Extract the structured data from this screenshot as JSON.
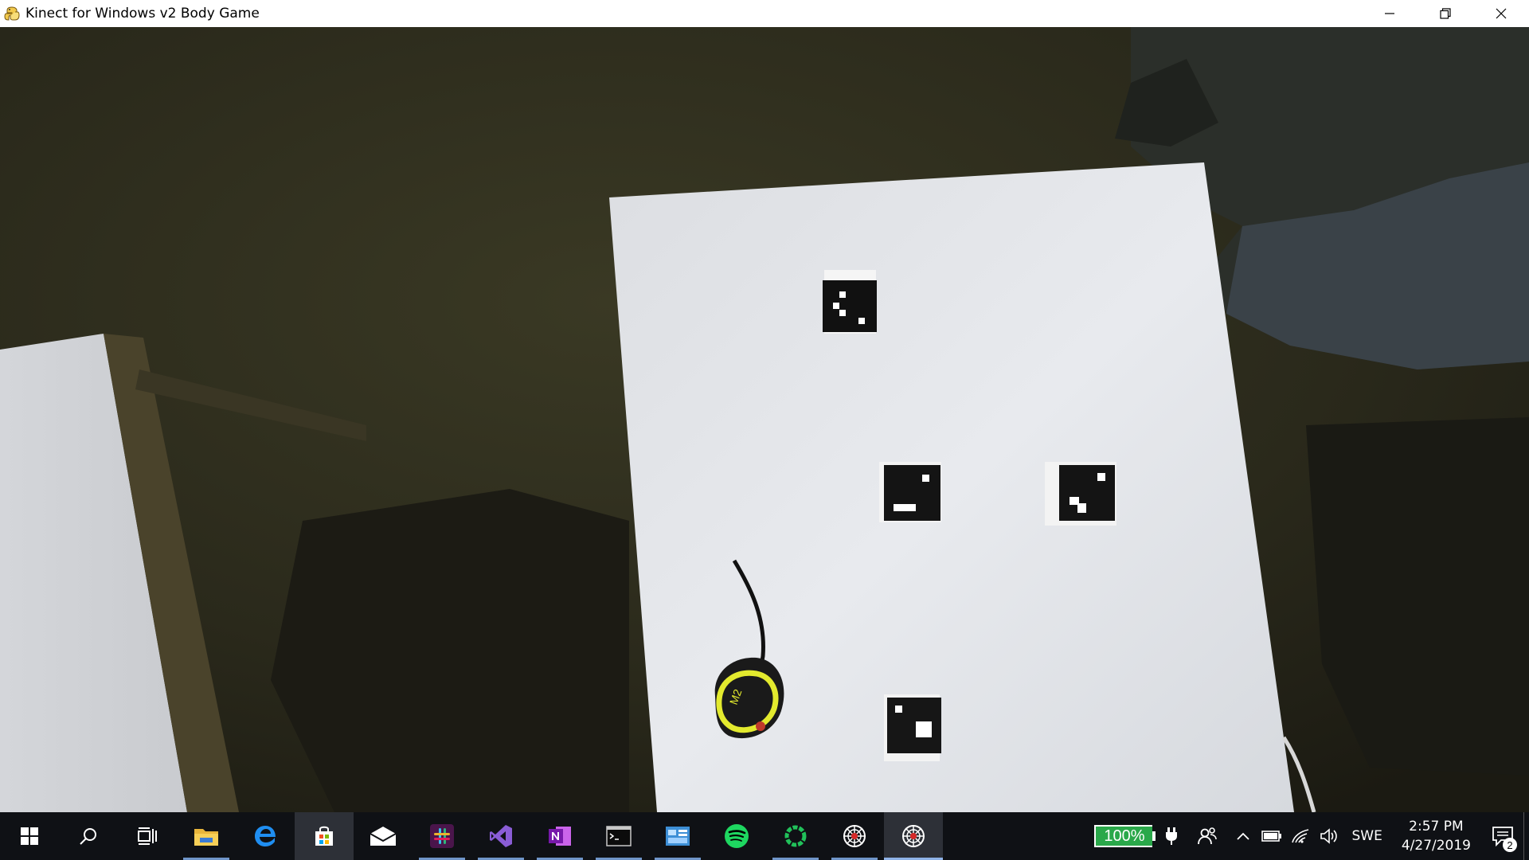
{
  "window": {
    "title": "Kinect for Windows v2 Body Game",
    "icon": "python-snake-icon",
    "controls": [
      "minimize-icon",
      "restore-icon",
      "close-icon"
    ]
  },
  "camera_view": {
    "objects": [
      "aruco-marker",
      "aruco-marker",
      "aruco-marker",
      "aruco-marker",
      "tape-measure"
    ],
    "tape_measure_label": "M2"
  },
  "taskbar": {
    "pinned": [
      {
        "name": "start",
        "icon": "windows-logo-icon",
        "running": false,
        "active": false
      },
      {
        "name": "search",
        "icon": "search-icon",
        "running": false,
        "active": false
      },
      {
        "name": "task-view",
        "icon": "task-view-icon",
        "running": false,
        "active": false
      },
      {
        "name": "file-explorer",
        "icon": "folder-icon",
        "running": true,
        "active": false
      },
      {
        "name": "edge",
        "icon": "edge-icon",
        "running": false,
        "active": false
      },
      {
        "name": "store",
        "icon": "store-icon",
        "running": false,
        "active": true
      },
      {
        "name": "mail",
        "icon": "mail-icon",
        "running": false,
        "active": false
      },
      {
        "name": "slack",
        "icon": "slack-icon",
        "running": true,
        "active": false
      },
      {
        "name": "visual-studio",
        "icon": "visual-studio-icon",
        "running": true,
        "active": false
      },
      {
        "name": "onenote",
        "icon": "onenote-icon",
        "running": true,
        "active": false
      },
      {
        "name": "terminal",
        "icon": "terminal-icon",
        "running": true,
        "active": false
      },
      {
        "name": "control-panel",
        "icon": "control-panel-icon",
        "running": true,
        "active": false
      },
      {
        "name": "spotify",
        "icon": "spotify-icon",
        "running": false,
        "active": false
      },
      {
        "name": "loader-app",
        "icon": "ring-icon",
        "running": true,
        "active": false
      },
      {
        "name": "kinect-game-1",
        "icon": "spider-web-icon",
        "running": true,
        "active": false
      },
      {
        "name": "kinect-game-2",
        "icon": "spider-web-icon",
        "running": true,
        "active": true
      }
    ],
    "tray": {
      "battery_percent": "100%",
      "language": "SWE",
      "time": "2:57 PM",
      "date": "4/27/2019",
      "notification_count": "2"
    }
  },
  "colors": {
    "battery_green": "#2aa84a",
    "taskbar": "#0f1115",
    "active_indicator": "#8fb3e8"
  }
}
